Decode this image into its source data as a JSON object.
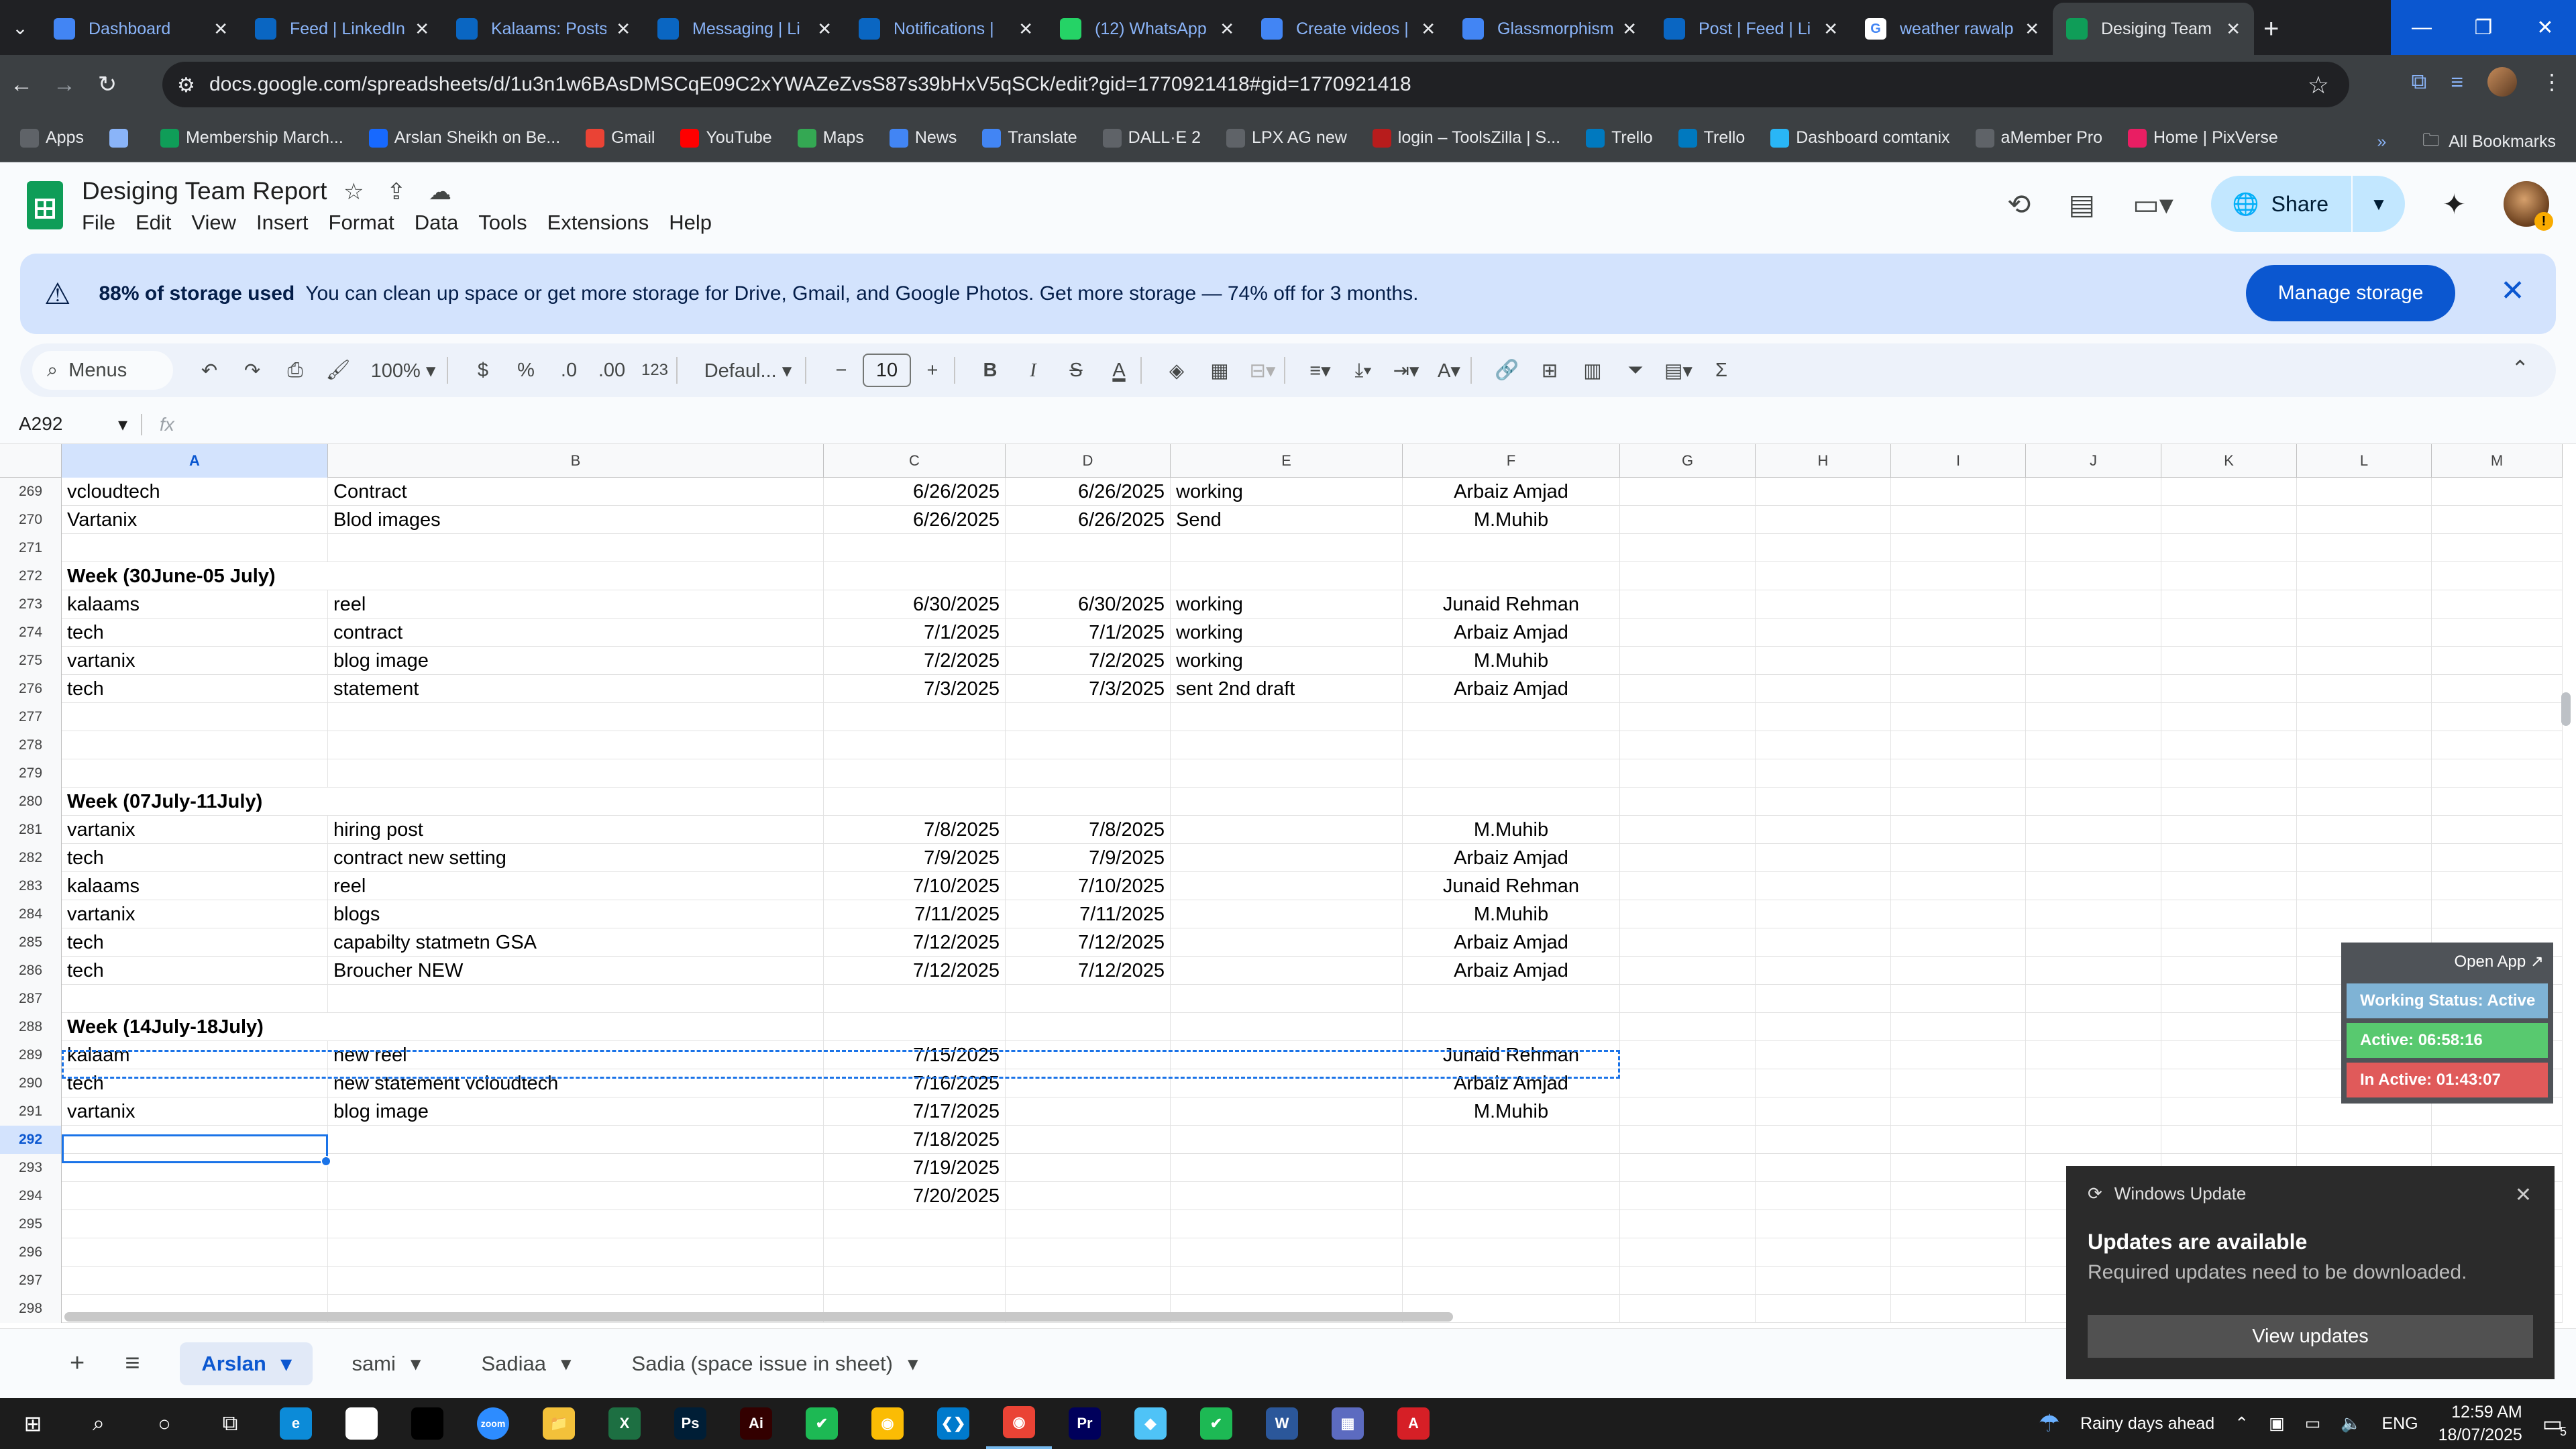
{
  "browser": {
    "tabs": [
      {
        "title": "Dashboard",
        "icon": "dashboard-icon",
        "color": "#4285f4"
      },
      {
        "title": "Feed | LinkedIn",
        "icon": "linkedin-icon",
        "color": "#0a66c2"
      },
      {
        "title": "Kalaams: Posts",
        "icon": "linkedin-icon",
        "color": "#0a66c2"
      },
      {
        "title": "Messaging | Li",
        "icon": "linkedin-icon",
        "color": "#0a66c2"
      },
      {
        "title": "Notifications |",
        "icon": "linkedin-icon",
        "color": "#0a66c2"
      },
      {
        "title": "(12) WhatsApp",
        "icon": "whatsapp-icon",
        "color": "#25d366"
      },
      {
        "title": "Create videos |",
        "icon": "docs-icon",
        "color": "#4285f4"
      },
      {
        "title": "Glassmorphism",
        "icon": "docs-icon",
        "color": "#4285f4"
      },
      {
        "title": "Post | Feed | Li",
        "icon": "linkedin-icon",
        "color": "#0a66c2"
      },
      {
        "title": "weather rawalp",
        "icon": "google-icon",
        "color": "#ffffff"
      },
      {
        "title": "Desiging Team",
        "icon": "sheets-icon",
        "color": "#0f9d58"
      }
    ],
    "url": "docs.google.com/spreadsheets/d/1u3n1w6BAsDMSCqE09C2xYWAZeZvsS87s39bHxV5qSCk/edit?gid=1770921418#gid=1770921418",
    "bookmarks": [
      {
        "label": "Apps",
        "icon": "apps-grid-icon",
        "color": "#5f6368"
      },
      {
        "label": "",
        "icon": "grid-icon",
        "color": "#8ab4f8"
      },
      {
        "label": "Membership March...",
        "icon": "sheets-icon",
        "color": "#0f9d58"
      },
      {
        "label": "Arslan Sheikh on Be...",
        "icon": "behance-icon",
        "color": "#1769ff"
      },
      {
        "label": "Gmail",
        "icon": "gmail-icon",
        "color": "#ea4335"
      },
      {
        "label": "YouTube",
        "icon": "youtube-icon",
        "color": "#ff0000"
      },
      {
        "label": "Maps",
        "icon": "maps-icon",
        "color": "#34a853"
      },
      {
        "label": "News",
        "icon": "news-icon",
        "color": "#4285f4"
      },
      {
        "label": "Translate",
        "icon": "translate-icon",
        "color": "#4285f4"
      },
      {
        "label": "DALL·E 2",
        "icon": "openai-icon",
        "color": "#5f6368"
      },
      {
        "label": "LPX AG new",
        "icon": "dot-icon",
        "color": "#5f6368"
      },
      {
        "label": "login – ToolsZilla | S...",
        "icon": "toolszilla-icon",
        "color": "#b71c1c"
      },
      {
        "label": "Trello",
        "icon": "trello-icon",
        "color": "#0079bf"
      },
      {
        "label": "Trello",
        "icon": "trello-icon",
        "color": "#0079bf"
      },
      {
        "label": "Dashboard comtanix",
        "icon": "comtanix-icon",
        "color": "#29b6f6"
      },
      {
        "label": "aMember Pro",
        "icon": "amember-icon",
        "color": "#5f6368"
      },
      {
        "label": "Home | PixVerse",
        "icon": "pixverse-icon",
        "color": "#e91e63"
      }
    ],
    "all_bookmarks": "All Bookmarks"
  },
  "doc": {
    "title": "Desiging Team Report",
    "menu": [
      "File",
      "Edit",
      "View",
      "Insert",
      "Format",
      "Data",
      "Tools",
      "Extensions",
      "Help"
    ],
    "share_label": "Share"
  },
  "banner": {
    "bold": "88% of storage used",
    "text": "You can clean up space or get more storage for Drive, Gmail, and Google Photos. Get more storage — 74% off for 3 months.",
    "button": "Manage storage"
  },
  "toolbar": {
    "menus_label": "Menus",
    "zoom": "100%",
    "currency": "$",
    "percent": "%",
    "dec_less": ".0",
    "dec_more": ".00",
    "number_format": "123",
    "font": "Defaul...",
    "font_size": "10"
  },
  "formula": {
    "namebox": "A292",
    "fx": "fx"
  },
  "grid": {
    "columns": [
      "A",
      "B",
      "C",
      "D",
      "E",
      "F",
      "G",
      "H",
      "I",
      "J",
      "K",
      "L",
      "M"
    ],
    "selected_column": "A",
    "selected_row": "292",
    "rows": [
      {
        "n": "269",
        "a": "vcloudtech",
        "b": "Contract",
        "c": "6/26/2025",
        "d": "6/26/2025",
        "e": "working",
        "f": "Arbaiz Amjad"
      },
      {
        "n": "270",
        "a": "Vartanix",
        "b": "Blod images",
        "c": "6/26/2025",
        "d": "6/26/2025",
        "e": "Send",
        "f": "M.Muhib"
      },
      {
        "n": "271",
        "a": "",
        "b": "",
        "c": "",
        "d": "",
        "e": "",
        "f": ""
      },
      {
        "n": "272",
        "a": "Week (30June-05 July)",
        "b": "",
        "c": "",
        "d": "",
        "e": "",
        "f": "",
        "bold": true
      },
      {
        "n": "273",
        "a": "kalaams",
        "b": "reel",
        "c": "6/30/2025",
        "d": "6/30/2025",
        "e": "working",
        "f": "Junaid Rehman"
      },
      {
        "n": "274",
        "a": "tech",
        "b": "contract",
        "c": "7/1/2025",
        "d": "7/1/2025",
        "e": "working",
        "f": "Arbaiz Amjad"
      },
      {
        "n": "275",
        "a": "vartanix",
        "b": "blog image",
        "c": "7/2/2025",
        "d": "7/2/2025",
        "e": "working",
        "f": "M.Muhib"
      },
      {
        "n": "276",
        "a": "tech",
        "b": "statement",
        "c": "7/3/2025",
        "d": "7/3/2025",
        "e": "sent 2nd draft",
        "f": "Arbaiz Amjad"
      },
      {
        "n": "277",
        "a": "",
        "b": "",
        "c": "",
        "d": "",
        "e": "",
        "f": ""
      },
      {
        "n": "278",
        "a": "",
        "b": "",
        "c": "",
        "d": "",
        "e": "",
        "f": ""
      },
      {
        "n": "279",
        "a": "",
        "b": "",
        "c": "",
        "d": "",
        "e": "",
        "f": ""
      },
      {
        "n": "280",
        "a": "Week (07July-11July)",
        "b": "",
        "c": "",
        "d": "",
        "e": "",
        "f": "",
        "bold": true
      },
      {
        "n": "281",
        "a": "vartanix",
        "b": "hiring post",
        "c": "7/8/2025",
        "d": "7/8/2025",
        "e": "",
        "f": "M.Muhib"
      },
      {
        "n": "282",
        "a": "tech",
        "b": "contract new setting",
        "c": "7/9/2025",
        "d": "7/9/2025",
        "e": "",
        "f": "Arbaiz Amjad"
      },
      {
        "n": "283",
        "a": "kalaams",
        "b": "reel",
        "c": "7/10/2025",
        "d": "7/10/2025",
        "e": "",
        "f": "Junaid Rehman"
      },
      {
        "n": "284",
        "a": "vartanix",
        "b": "blogs",
        "c": "7/11/2025",
        "d": "7/11/2025",
        "e": "",
        "f": "M.Muhib"
      },
      {
        "n": "285",
        "a": "tech",
        "b": "capabilty statmetn GSA",
        "c": "7/12/2025",
        "d": "7/12/2025",
        "e": "",
        "f": "Arbaiz Amjad"
      },
      {
        "n": "286",
        "a": "tech",
        "b": "Broucher NEW",
        "c": "7/12/2025",
        "d": "7/12/2025",
        "e": "",
        "f": "Arbaiz Amjad"
      },
      {
        "n": "287",
        "a": "",
        "b": "",
        "c": "",
        "d": "",
        "e": "",
        "f": ""
      },
      {
        "n": "288",
        "a": "Week (14July-18July)",
        "b": "",
        "c": "",
        "d": "",
        "e": "",
        "f": "",
        "bold": true
      },
      {
        "n": "289",
        "a": "kalaam",
        "b": "new reel",
        "c": "7/15/2025",
        "d": "",
        "e": "",
        "f": "Junaid Rehman"
      },
      {
        "n": "290",
        "a": "tech",
        "b": "new statement vcloudtech",
        "c": "7/16/2025",
        "d": "",
        "e": "",
        "f": "Arbaiz Amjad"
      },
      {
        "n": "291",
        "a": "vartanix",
        "b": "blog image",
        "c": "7/17/2025",
        "d": "",
        "e": "",
        "f": "M.Muhib"
      },
      {
        "n": "292",
        "a": "",
        "b": "",
        "c": "7/18/2025",
        "d": "",
        "e": "",
        "f": ""
      },
      {
        "n": "293",
        "a": "",
        "b": "",
        "c": "7/19/2025",
        "d": "",
        "e": "",
        "f": ""
      },
      {
        "n": "294",
        "a": "",
        "b": "",
        "c": "7/20/2025",
        "d": "",
        "e": "",
        "f": ""
      },
      {
        "n": "295",
        "a": "",
        "b": "",
        "c": "",
        "d": "",
        "e": "",
        "f": ""
      },
      {
        "n": "296",
        "a": "",
        "b": "",
        "c": "",
        "d": "",
        "e": "",
        "f": ""
      },
      {
        "n": "297",
        "a": "",
        "b": "",
        "c": "",
        "d": "",
        "e": "",
        "f": ""
      },
      {
        "n": "298",
        "a": "",
        "b": "",
        "c": "",
        "d": "",
        "e": "",
        "f": ""
      }
    ]
  },
  "sheets": [
    {
      "name": "Arslan",
      "active": true
    },
    {
      "name": "sami",
      "active": false
    },
    {
      "name": "Sadiaa",
      "active": false
    },
    {
      "name": "Sadia (space issue in sheet)",
      "active": false
    }
  ],
  "status_widget": {
    "open_app": "Open App ↗",
    "working": "Working Status: Active",
    "active": "Active: 06:58:16",
    "inactive": "In Active: 01:43:07",
    "colors": {
      "working": "#7fb3d5",
      "active": "#58c96f",
      "inactive": "#e05a5a"
    }
  },
  "toast": {
    "app": "Windows Update",
    "title": "Updates are available",
    "body": "Required updates need to be downloaded.",
    "button": "View updates"
  },
  "taskbar": {
    "apps": [
      {
        "icon": "windows-start-icon",
        "color": "#ffffff",
        "label": "⊞"
      },
      {
        "icon": "search-icon",
        "color": "#ffffff",
        "label": "⌕"
      },
      {
        "icon": "cortana-icon",
        "color": "#ffffff",
        "label": "○"
      },
      {
        "icon": "task-view-icon",
        "color": "#ffffff",
        "label": "⧉"
      },
      {
        "icon": "edge-icon",
        "color": "#0c8bd8",
        "label": "e"
      },
      {
        "icon": "pen-icon",
        "color": "#ffffff",
        "label": "✎"
      },
      {
        "icon": "terminal-icon",
        "color": "#000000",
        "label": ""
      },
      {
        "icon": "zoom-icon",
        "color": "#2d8cff",
        "label": "zoom"
      },
      {
        "icon": "file-explorer-icon",
        "color": "#f3c13a",
        "label": "📁"
      },
      {
        "icon": "excel-icon",
        "color": "#1d6f42",
        "label": "X"
      },
      {
        "icon": "photoshop-icon",
        "color": "#001e36",
        "label": "Ps"
      },
      {
        "icon": "illustrator-icon",
        "color": "#330000",
        "label": "Ai"
      },
      {
        "icon": "green-app-icon",
        "color": "#1db954",
        "label": "✔"
      },
      {
        "icon": "chrome-icon",
        "color": "#fbbc04",
        "label": "◉"
      },
      {
        "icon": "vscode-icon",
        "color": "#007acc",
        "label": "❮❯"
      },
      {
        "icon": "chrome-open-icon",
        "color": "#ea4335",
        "label": "◉"
      },
      {
        "icon": "premiere-icon",
        "color": "#00005b",
        "label": "Pr"
      },
      {
        "icon": "diamond-app-icon",
        "color": "#4fc3f7",
        "label": "◆"
      },
      {
        "icon": "green-app-icon-2",
        "color": "#1db954",
        "label": "✔"
      },
      {
        "icon": "word-icon",
        "color": "#2b579a",
        "label": "W"
      },
      {
        "icon": "calculator-icon",
        "color": "#5c6bc0",
        "label": "▦"
      },
      {
        "icon": "acrobat-icon",
        "color": "#d61f26",
        "label": "A"
      }
    ],
    "weather": "Rainy days ahead",
    "lang": "ENG",
    "time": "12:59 AM",
    "date": "18/07/2025",
    "notifications": "5"
  }
}
